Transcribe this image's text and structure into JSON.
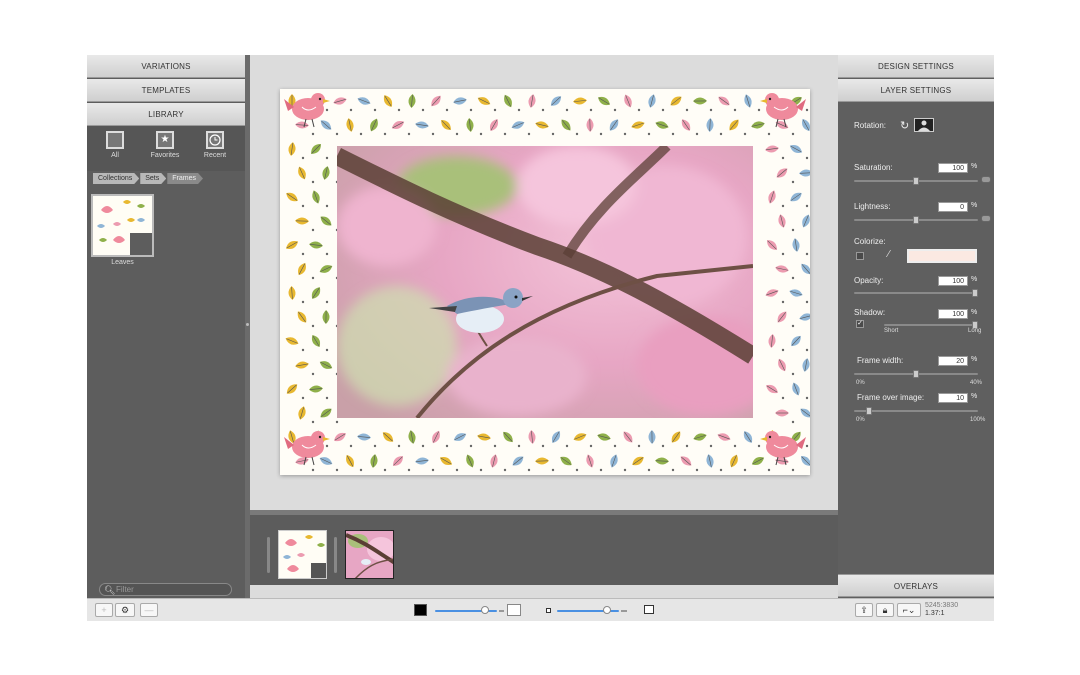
{
  "left": {
    "tabs": [
      "VARIATIONS",
      "TEMPLATES",
      "LIBRARY"
    ],
    "library_buttons": [
      {
        "label": "All",
        "icon": "square-icon"
      },
      {
        "label": "Favorites",
        "icon": "star-icon"
      },
      {
        "label": "Recent",
        "icon": "clock-icon"
      }
    ],
    "breadcrumb": [
      "Collections",
      "Sets",
      "Frames"
    ],
    "thumbnail_label": "Leaves",
    "filter_placeholder": "Filter"
  },
  "right": {
    "tabs": [
      "DESIGN SETTINGS",
      "LAYER SETTINGS"
    ],
    "rotation_label": "Rotation:",
    "saturation": {
      "label": "Saturation:",
      "value": "100",
      "unit": "%",
      "level": 0.5
    },
    "lightness": {
      "label": "Lightness:",
      "value": "0",
      "unit": "%",
      "level": 0.5
    },
    "colorize": {
      "label": "Colorize:",
      "color": "#fbe9e2"
    },
    "opacity": {
      "label": "Opacity:",
      "value": "100",
      "unit": "%",
      "level": 1.0
    },
    "shadow": {
      "label": "Shadow:",
      "value": "100",
      "unit": "%",
      "min": "Short",
      "max": "Long",
      "level": 1.0
    },
    "frame_width": {
      "label": "Frame width:",
      "value": "20",
      "unit": "%",
      "min": "0%",
      "max": "40%",
      "level": 0.5
    },
    "frame_over": {
      "label": "Frame over image:",
      "value": "10",
      "unit": "%",
      "min": "0%",
      "max": "100%",
      "level": 0.1
    },
    "overlays": "OVERLAYS"
  },
  "status": {
    "dims": "5245:3830",
    "ratio": "1.37:1",
    "zoom_level": 0.85,
    "size_level": 0.85
  },
  "colors": {
    "leaf_yellow": "#e8b830",
    "leaf_green": "#8fb04a",
    "leaf_pink": "#ec9bb0",
    "leaf_blue": "#8fb5d6",
    "bird_pink": "#ef8a9c"
  }
}
